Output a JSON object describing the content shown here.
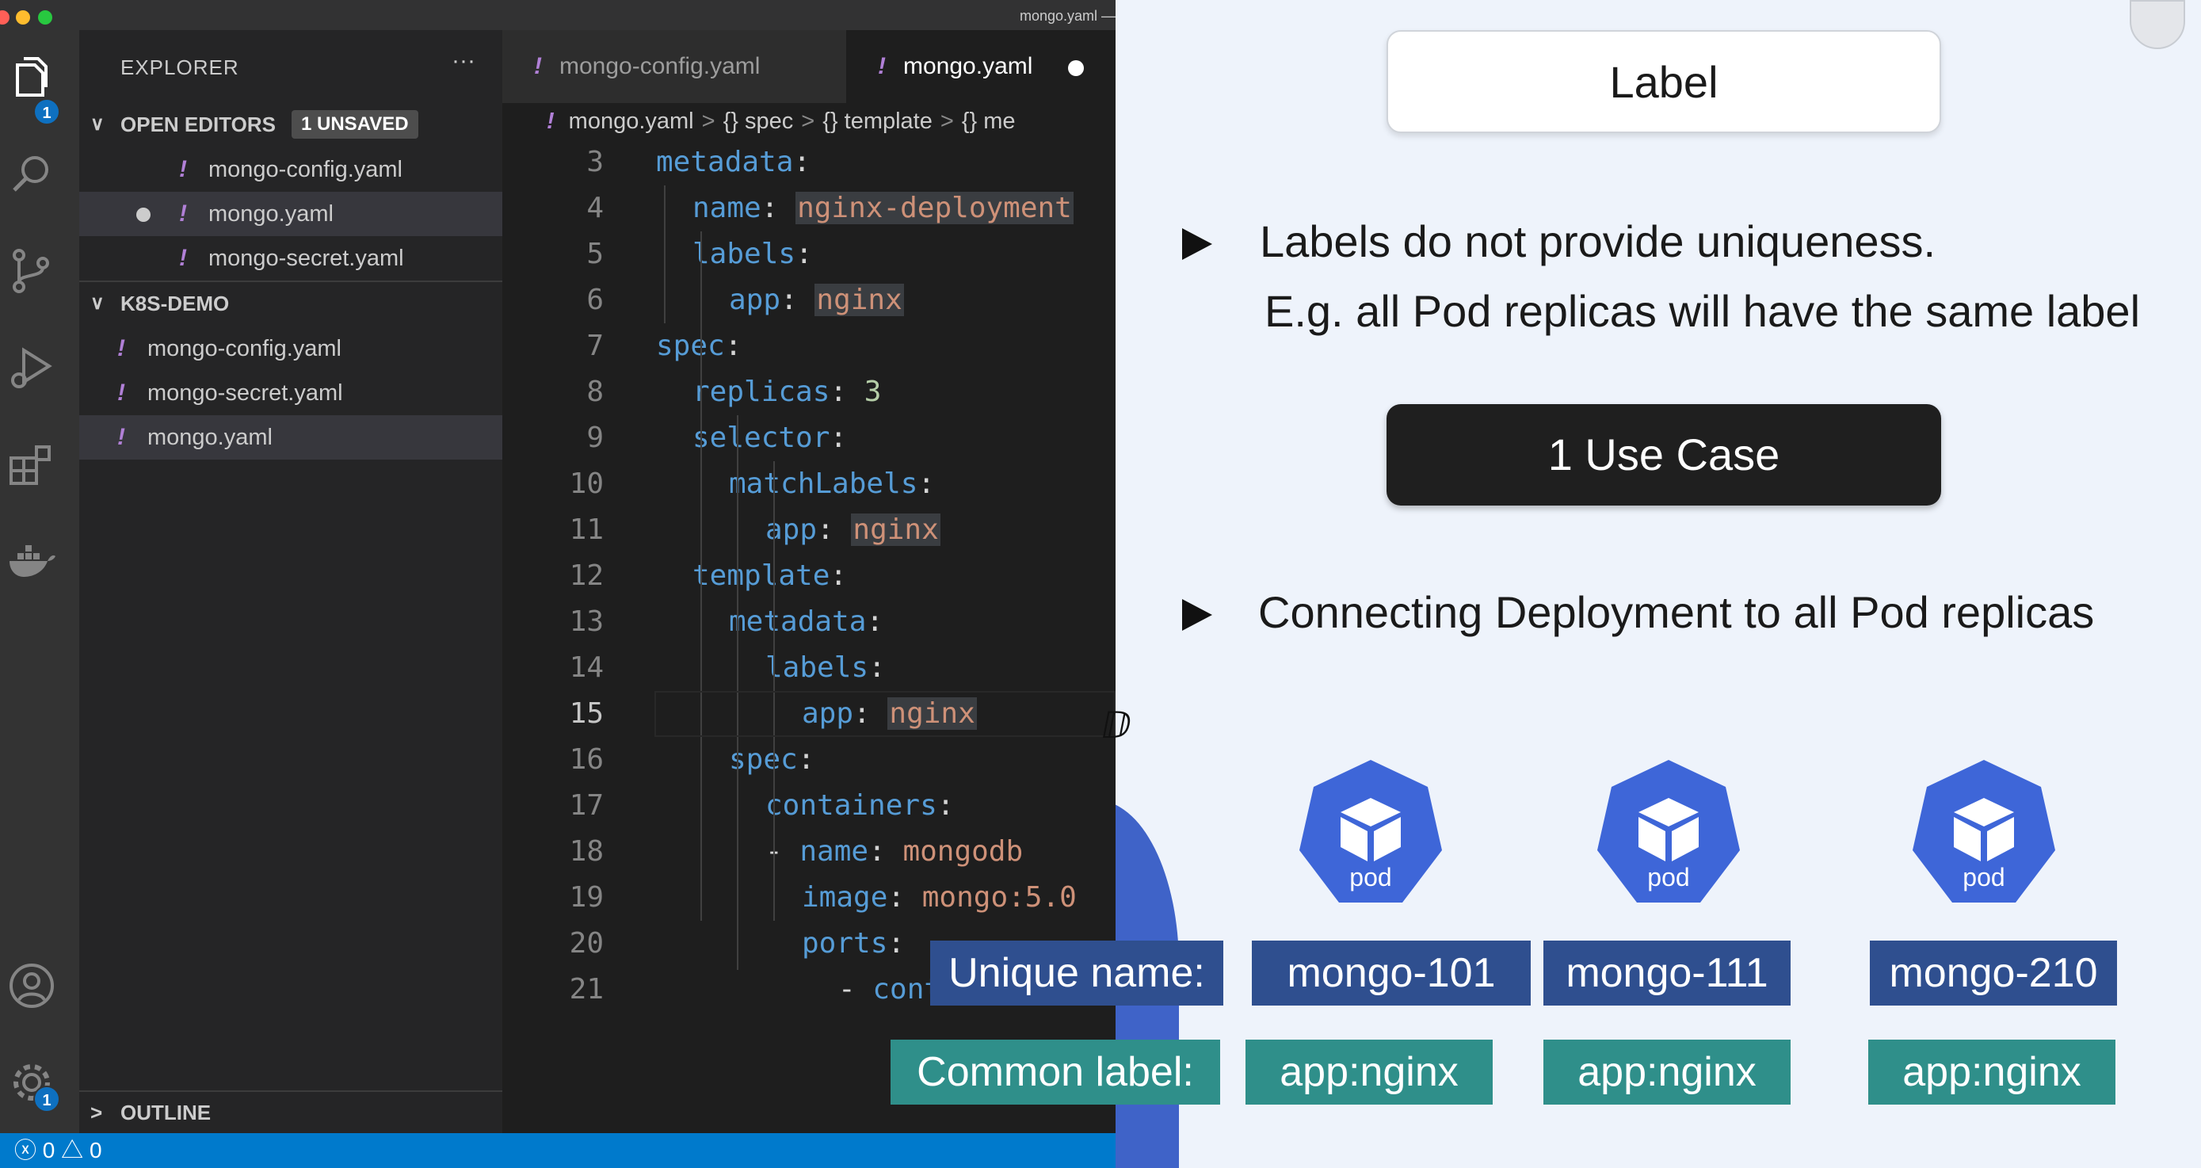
{
  "window": {
    "title": "mongo.yaml —"
  },
  "activity_bar": {
    "explorer_badge": "1",
    "settings_badge": "1",
    "icons": [
      "files-icon",
      "search-icon",
      "source-control-icon",
      "run-debug-icon",
      "extensions-icon",
      "docker-icon",
      "account-icon",
      "gear-icon"
    ]
  },
  "sidebar": {
    "title": "EXPLORER",
    "more": "···",
    "open_editors": {
      "label": "OPEN EDITORS",
      "badge": "1 UNSAVED",
      "files": [
        "mongo-config.yaml",
        "mongo.yaml",
        "mongo-secret.yaml"
      ]
    },
    "project": {
      "label": "K8S-DEMO",
      "files": [
        "mongo-config.yaml",
        "mongo-secret.yaml",
        "mongo.yaml"
      ]
    },
    "outline": "OUTLINE"
  },
  "editor": {
    "tabs": [
      {
        "label": "mongo-config.yaml"
      },
      {
        "label": "mongo.yaml"
      }
    ],
    "breadcrumb": [
      "mongo.yaml",
      "{} spec",
      "{} template",
      "{} me"
    ],
    "lines": [
      {
        "n": "3",
        "key": "metadata",
        "val": ""
      },
      {
        "n": "4",
        "key": "name",
        "val": "nginx-deployment"
      },
      {
        "n": "5",
        "key": "labels",
        "val": ""
      },
      {
        "n": "6",
        "key": "app",
        "val": "nginx"
      },
      {
        "n": "7",
        "key": "spec",
        "val": ""
      },
      {
        "n": "8",
        "key": "replicas",
        "val": "3"
      },
      {
        "n": "9",
        "key": "selector",
        "val": ""
      },
      {
        "n": "10",
        "key": "matchLabels",
        "val": ""
      },
      {
        "n": "11",
        "key": "app",
        "val": "nginx"
      },
      {
        "n": "12",
        "key": "template",
        "val": ""
      },
      {
        "n": "13",
        "key": "metadata",
        "val": ""
      },
      {
        "n": "14",
        "key": "labels",
        "val": ""
      },
      {
        "n": "15",
        "key": "app",
        "val": "nginx"
      },
      {
        "n": "16",
        "key": "spec",
        "val": ""
      },
      {
        "n": "17",
        "key": "containers",
        "val": ""
      },
      {
        "n": "18",
        "key": "name",
        "val": "mongodb"
      },
      {
        "n": "19",
        "key": "image",
        "val": "mongo:5.0"
      },
      {
        "n": "20",
        "key": "ports",
        "val": ""
      },
      {
        "n": "21",
        "key": "conta",
        "val": ""
      }
    ]
  },
  "status": {
    "errors": "0",
    "warnings": "0"
  },
  "slide": {
    "title": "Label",
    "bullet1": "Labels do not provide uniqueness.",
    "bullet1_sub": "E.g. all Pod replicas will have the same label",
    "use_case": "1 Use Case",
    "bullet2": "Connecting Deployment to all Pod replicas",
    "pod_label": "pod",
    "unique_name_label": "Unique name:",
    "common_label_label": "Common label:",
    "pods": [
      {
        "name": "mongo-101",
        "label": "app:nginx"
      },
      {
        "name": "mongo-111",
        "label": "app:nginx"
      },
      {
        "name": "mongo-210",
        "label": "app:nginx"
      }
    ],
    "colors": {
      "pod": "#3e66d8",
      "name_box": "#2f4f8f",
      "label_box": "#2f8f8a"
    }
  }
}
